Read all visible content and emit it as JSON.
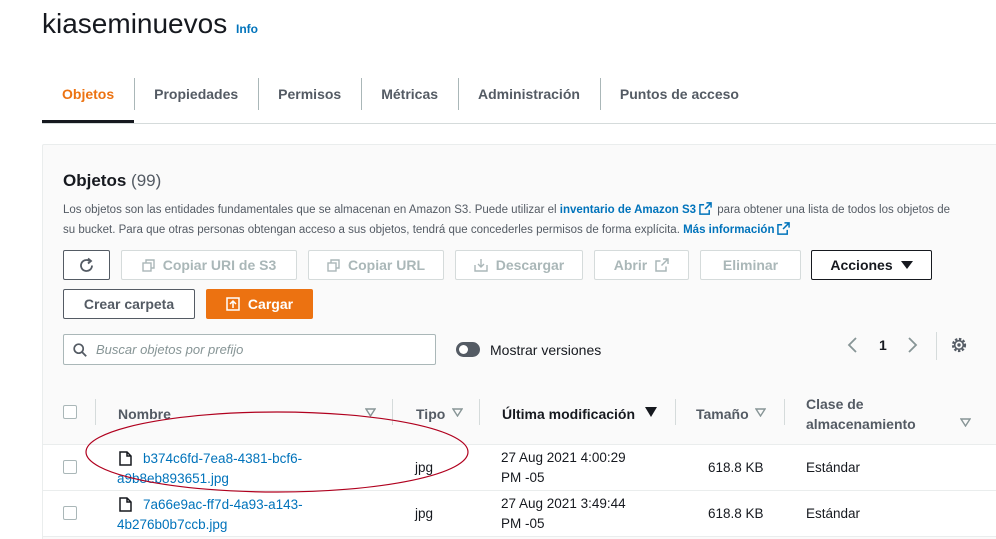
{
  "header": {
    "bucket_name": "kiaseminuevos",
    "info_label": "Info"
  },
  "tabs": [
    {
      "label": "Objetos",
      "active": true
    },
    {
      "label": "Propiedades"
    },
    {
      "label": "Permisos"
    },
    {
      "label": "Métricas"
    },
    {
      "label": "Administración"
    },
    {
      "label": "Puntos de acceso"
    }
  ],
  "objects_panel": {
    "title": "Objetos",
    "count": "(99)",
    "desc_part1": "Los objetos son las entidades fundamentales que se almacenan en Amazon S3. Puede utilizar el ",
    "inventory_link": "inventario de Amazon S3",
    "desc_part2": " para obtener una lista de todos los objetos de su bucket. Para que otras personas obtengan acceso a sus objetos, tendrá que concederles permisos de forma explícita. ",
    "more_info_link": "Más información"
  },
  "toolbar": {
    "copy_uri": "Copiar URI de S3",
    "copy_url": "Copiar URL",
    "download": "Descargar",
    "open": "Abrir",
    "delete": "Eliminar",
    "actions": "Acciones",
    "create_folder": "Crear carpeta",
    "upload": "Cargar"
  },
  "search": {
    "placeholder": "Buscar objetos por prefijo"
  },
  "versions_toggle": {
    "label": "Mostrar versiones"
  },
  "pagination": {
    "current_page": "1"
  },
  "table": {
    "columns": {
      "name": "Nombre",
      "type": "Tipo",
      "modified": "Última modificación",
      "size": "Tamaño",
      "storage_line1": "Clase de",
      "storage_line2": "almacenamiento"
    },
    "rows": [
      {
        "name": "b374c6fd-7ea8-4381-bcf6-a9b8eb893651.jpg",
        "type": "jpg",
        "modified_line1": "27 Aug 2021 4:00:29",
        "modified_line2": "PM -05",
        "size": "618.8 KB",
        "storage": "Estándar"
      },
      {
        "name": "7a66e9ac-ff7d-4a93-a143-4b276b0b7ccb.jpg",
        "type": "jpg",
        "modified_line1": "27 Aug 2021 3:49:44",
        "modified_line2": "PM -05",
        "size": "618.8 KB",
        "storage": "Estándar"
      }
    ]
  },
  "colors": {
    "accent": "#ec7211",
    "link": "#0073bb",
    "annotation": "#b0001e"
  }
}
